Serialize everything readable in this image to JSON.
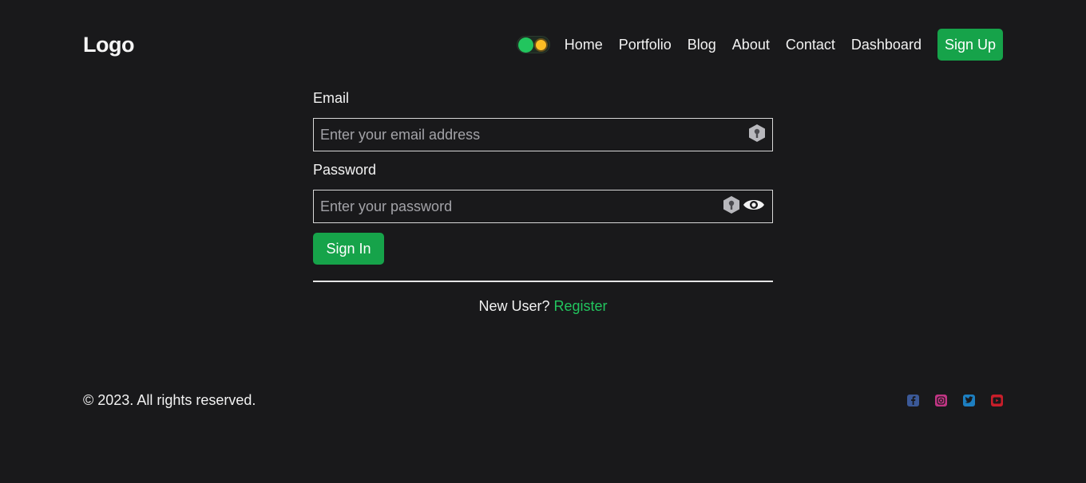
{
  "header": {
    "logo": "Logo",
    "nav": [
      "Home",
      "Portfolio",
      "Blog",
      "About",
      "Contact",
      "Dashboard"
    ],
    "signup_label": "Sign Up",
    "theme_toggle": {
      "state": "on",
      "icon": "sun-icon",
      "color": "#22c55e"
    }
  },
  "form": {
    "email_label": "Email",
    "email_placeholder": "Enter your email address",
    "email_value": "",
    "password_label": "Password",
    "password_placeholder": "Enter your password",
    "password_value": "",
    "signin_label": "Sign In",
    "new_user_text": "New User?",
    "register_label": "Register"
  },
  "footer": {
    "copyright": "© 2023. All rights reserved.",
    "socials": [
      {
        "name": "facebook-icon",
        "color": "#3b5998"
      },
      {
        "name": "instagram-icon",
        "color": "#c13584"
      },
      {
        "name": "twitter-icon",
        "color": "#1da1f2"
      },
      {
        "name": "youtube-icon",
        "color": "#e11d2a"
      }
    ]
  },
  "colors": {
    "background": "#19191b",
    "accent": "#16a34a",
    "link": "#22c55e",
    "text": "#f2f2f2"
  }
}
